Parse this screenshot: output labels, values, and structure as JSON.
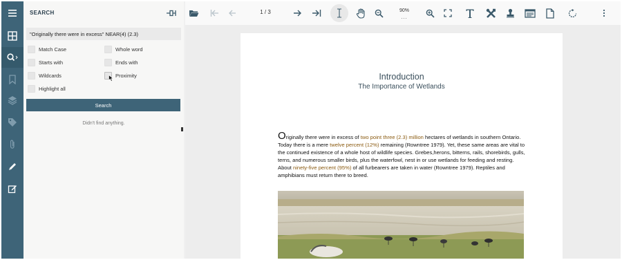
{
  "sidebar_rail": {
    "items": [
      {
        "name": "menu",
        "icon": "hamburger-menu-icon"
      },
      {
        "name": "thumbnails",
        "icon": "grid-icon"
      },
      {
        "name": "search",
        "icon": "search-icon"
      },
      {
        "name": "bookmarks",
        "icon": "bookmark-icon"
      },
      {
        "name": "layers",
        "icon": "layers-icon"
      },
      {
        "name": "tags",
        "icon": "tag-icon"
      },
      {
        "name": "attachments",
        "icon": "paperclip-icon"
      },
      {
        "name": "annotate",
        "icon": "pencil-icon"
      },
      {
        "name": "edit",
        "icon": "edit-form-icon"
      }
    ]
  },
  "search_panel": {
    "title": "SEARCH",
    "query": "\"Originally there were in excess\" NEAR(4) (2.3)",
    "options": {
      "match_case": "Match Case",
      "whole_word": "Whole word",
      "starts_with": "Starts with",
      "ends_with": "Ends with",
      "wildcards": "Wildcards",
      "proximity": "Proximity",
      "highlight_all": "Highlight all"
    },
    "search_button": "Search",
    "result_message": "Didn't find anything."
  },
  "toolbar": {
    "page_indicator": "1 / 3",
    "zoom": "90%",
    "zoom_more": "...",
    "icons": [
      "folder-open-icon",
      "first-page-icon",
      "previous-page-icon",
      "next-page-icon",
      "last-page-icon",
      "text-select-icon",
      "pan-hand-icon",
      "zoom-out-icon",
      "zoom-in-icon",
      "fit-page-icon",
      "text-tool-icon",
      "crossed-tools-icon",
      "stamp-icon",
      "form-icon",
      "document-icon",
      "rotate-icon",
      "more-options-icon"
    ]
  },
  "document": {
    "title": "Introduction",
    "subtitle": "The Importance of Wetlands",
    "para": {
      "dropcap": "O",
      "t1": "riginally there were in excess of ",
      "h1": "two point three (2.3) million",
      "t2": " hectares of wetlands in southern Ontario. Today there is a mere ",
      "h2": "twelve percent (12%)",
      "t3": " remaining (Rowntree 1979). Yet, these same areas are vital to the continued existence of a whole host of wildlife species. Grebes,herons, bitterns, rails, shorebirds, gulls, terns, and numerous smaller birds, plus the waterfowl, nest in or use wetlands for feeding and resting. About ",
      "h3": "ninety-five percent (95%)",
      "t4": " of all furbearers are taken in water (Rowntree 1979). Reptiles and amphibians must return there to breed."
    }
  },
  "colors": {
    "rail": "#3e6478",
    "accent_button": "#3e6478",
    "highlight_text": "#8a5a10"
  }
}
